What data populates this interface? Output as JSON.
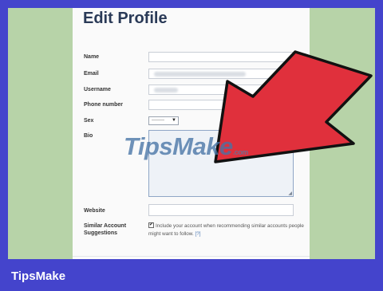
{
  "page": {
    "title": "Edit Profile"
  },
  "form": {
    "name_label": "Name",
    "email_label": "Email",
    "username_label": "Username",
    "phone_label": "Phone number",
    "sex_label": "Sex",
    "sex_value": "--------",
    "bio_label": "Bio",
    "website_label": "Website",
    "similar_label_line1": "Similar Account",
    "similar_label_line2": "Suggestions",
    "similar_text": "Include your account when recommending similar accounts people might want to follow.",
    "similar_help": "[?]",
    "similar_checked": "✔"
  },
  "watermark": {
    "text": "TipsMake",
    "suffix": ".com"
  },
  "brand": {
    "label": "TipsMake"
  },
  "colors": {
    "outer_border": "#4444cc",
    "frame": "#b7d3a8",
    "arrow": "#e0303c",
    "title": "#2a3a57"
  },
  "icons": {
    "select_chevron": "chevron-down-icon",
    "pointer": "red-arrow-icon",
    "resize": "resize-grip-icon"
  }
}
